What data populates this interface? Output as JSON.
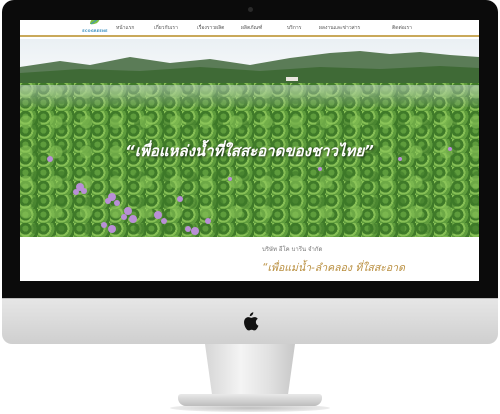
{
  "brand": {
    "logo_text": "ECOGREENE"
  },
  "nav": {
    "items": [
      {
        "label": "หน้าแรก"
      },
      {
        "label": "เกี่ยวกับเรา"
      },
      {
        "label": "เรื่องราวผลิต"
      },
      {
        "label": "ผลิตภัณฑ์"
      },
      {
        "label": "บริการ"
      },
      {
        "label": "ผลงานและข่าวสาร"
      },
      {
        "label": "ติดต่อเรา"
      }
    ]
  },
  "hero": {
    "title": "“เพื่อแหล่งน้ำที่ใสสะอาดของชาวไทย”"
  },
  "content": {
    "company_name": "บริษัท อีโค บารีน จำกัด",
    "tagline": "“เพื่อแม่น้ำ-ลำคลอง ที่ใสสะอาด"
  },
  "colors": {
    "accent": "#c9a95a",
    "tagline": "#b98e3e",
    "nav_text": "#555555"
  },
  "icons": {
    "device_logo": "apple-icon"
  }
}
